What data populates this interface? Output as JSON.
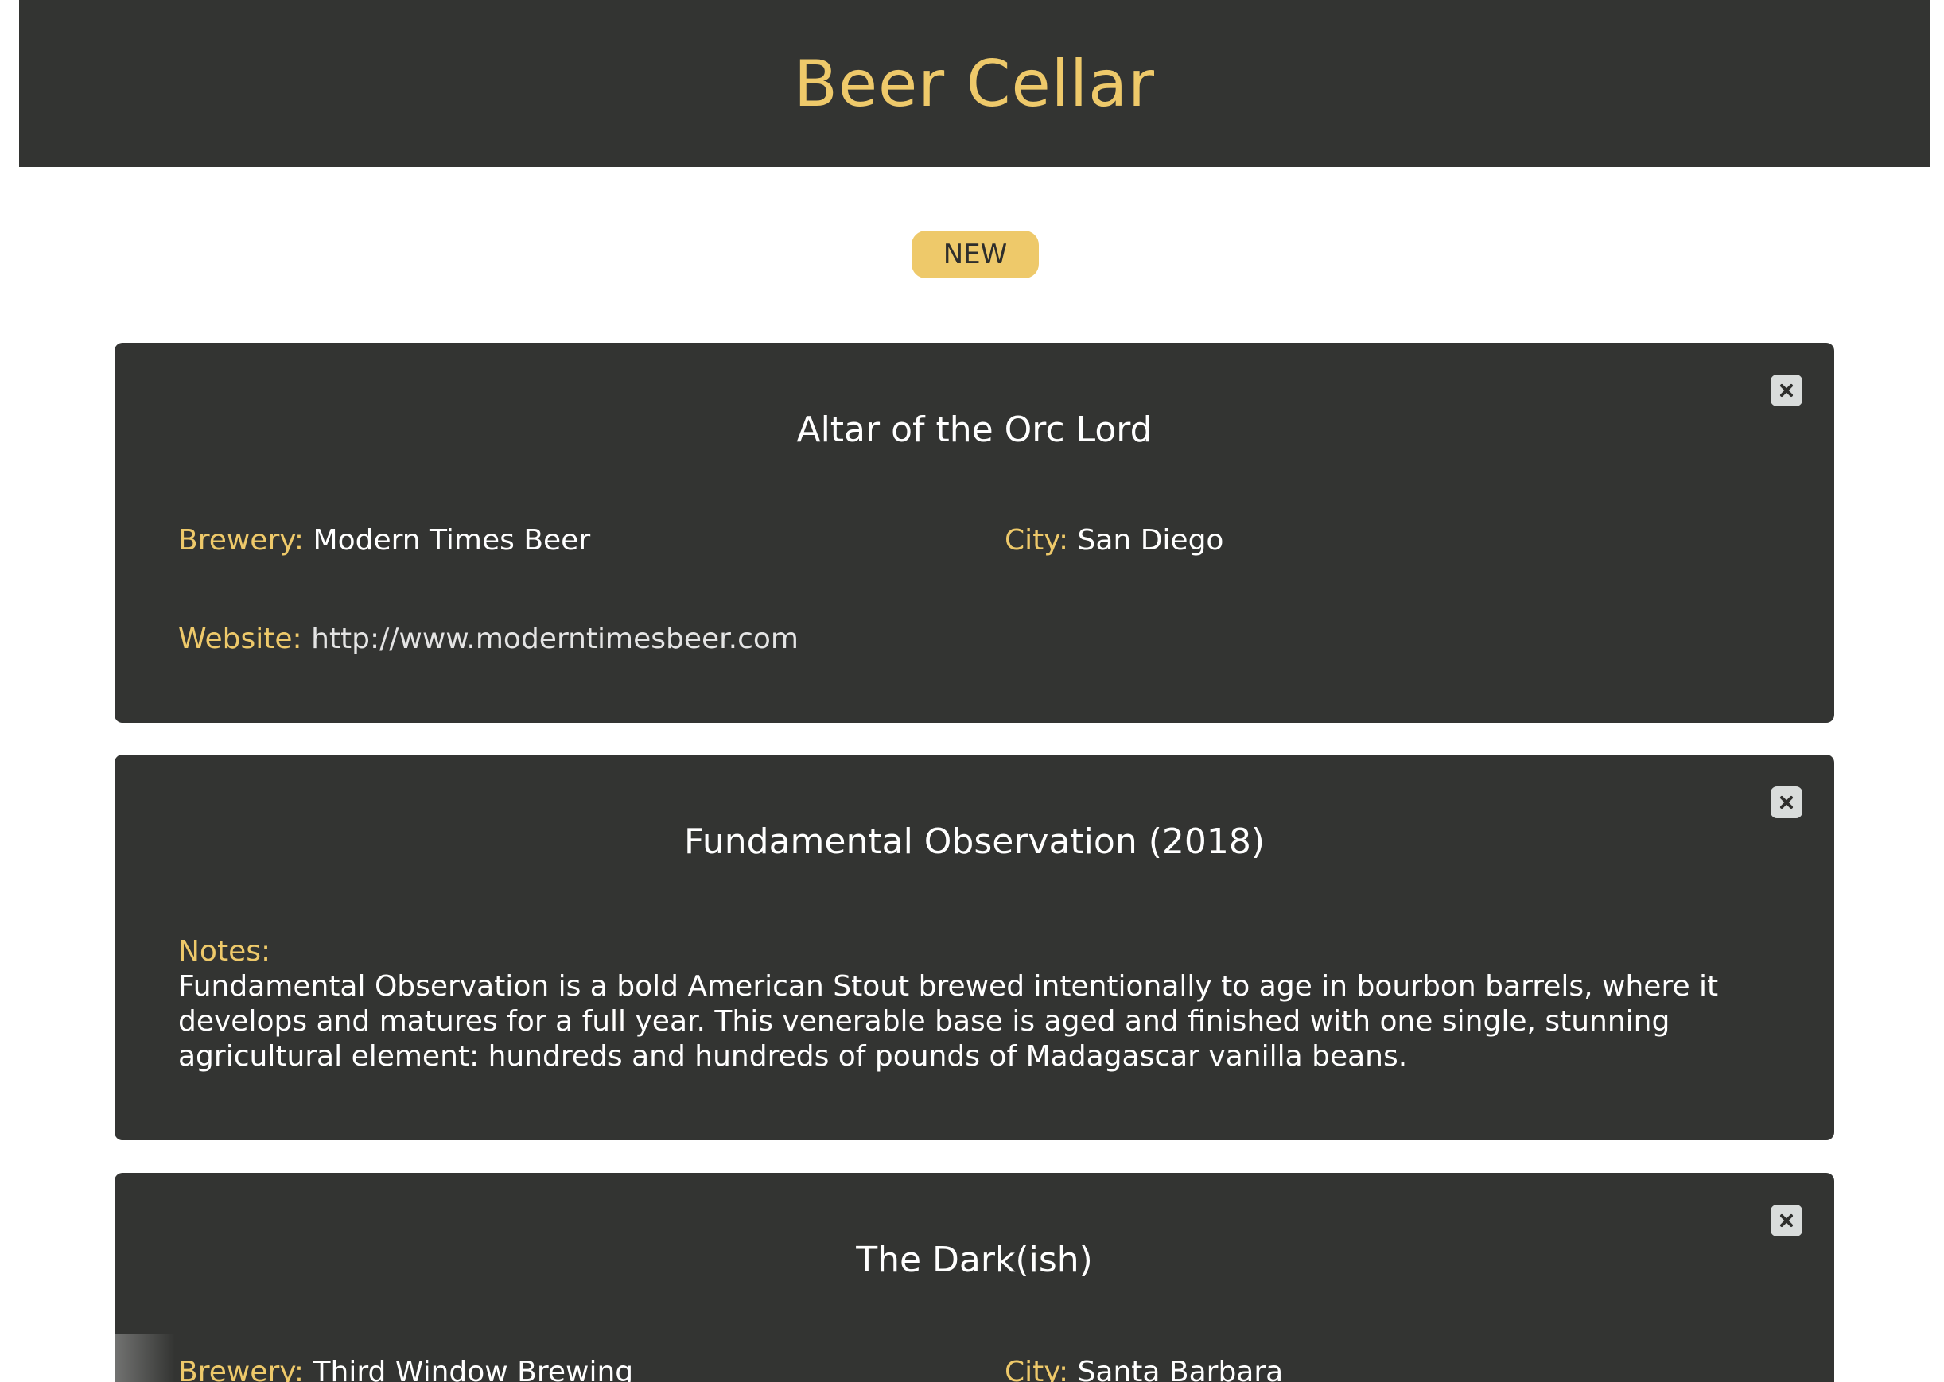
{
  "app": {
    "title": "Beer Cellar"
  },
  "toolbar": {
    "new_label": "NEW"
  },
  "beers": [
    {
      "name": "Altar of the Orc Lord",
      "brewery_label": "Brewery:",
      "brewery": "Modern Times Beer",
      "city_label": "City:",
      "city": "San Diego",
      "website_label": "Website:",
      "website": "http://www.moderntimesbeer.com"
    },
    {
      "name": "Fundamental Observation (2018)",
      "notes_label": "Notes:",
      "notes": "Fundamental Observation is a bold American Stout brewed intentionally to age in bourbon barrels, where it develops and matures for a full year. This venerable base is aged and finished with one single, stunning agricultural element: hundreds and hundreds of pounds of Madagascar vanilla beans."
    },
    {
      "name": "The Dark(ish)",
      "brewery_label": "Brewery:",
      "brewery": "Third Window Brewing",
      "city_label": "City:",
      "city": "Santa Barbara"
    }
  ],
  "colors": {
    "accent": "#eec96a",
    "card_bg": "#333432",
    "header_bg": "#333432",
    "close_bg": "#d9dcdb"
  },
  "icons": {
    "close": "close-icon"
  }
}
